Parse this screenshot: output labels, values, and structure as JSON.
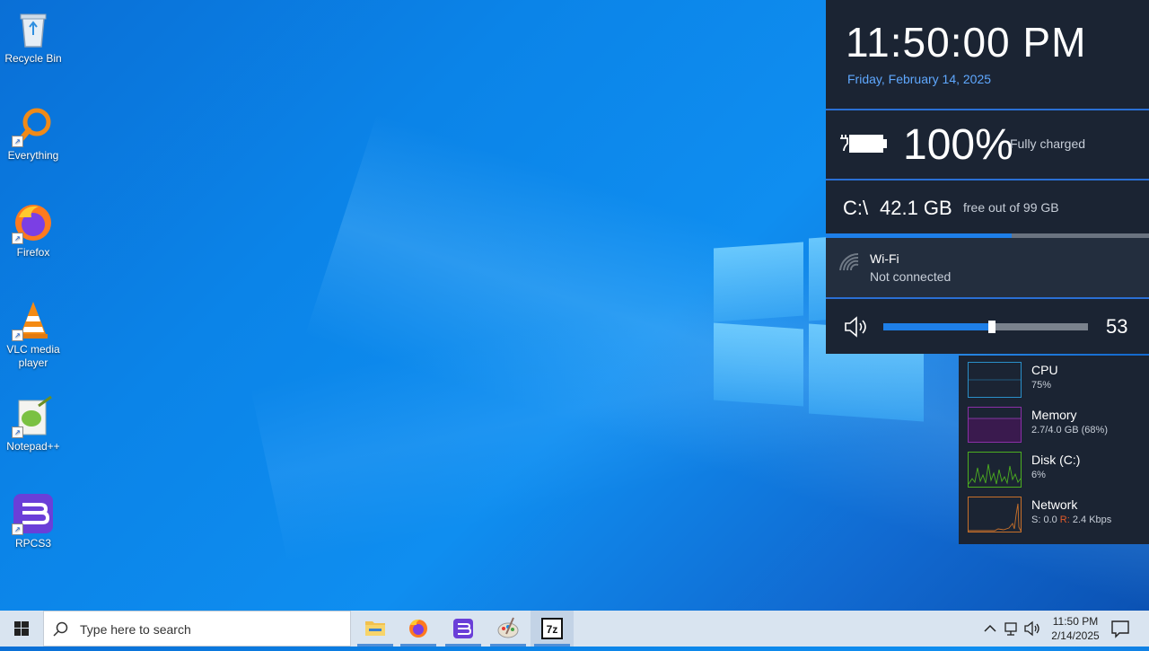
{
  "desktop": {
    "icons": [
      {
        "label": "Recycle Bin",
        "icon": "recycle-bin-icon"
      },
      {
        "label": "Everything",
        "icon": "everything-search-icon"
      },
      {
        "label": "Firefox",
        "icon": "firefox-icon"
      },
      {
        "label": "VLC media player",
        "icon": "vlc-icon"
      },
      {
        "label": "Notepad++",
        "icon": "notepadpp-icon"
      },
      {
        "label": "RPCS3",
        "icon": "rpcs3-icon"
      }
    ]
  },
  "flyout": {
    "time": "11:50:00 PM",
    "date": "Friday, February 14, 2025",
    "battery": {
      "percent_label": "100%",
      "status": "Fully charged"
    },
    "disk": {
      "drive": "C:\\",
      "free": "42.1 GB",
      "of": "free out of 99 GB",
      "used_fraction": 0.575
    },
    "wifi": {
      "name": "Wi-Fi",
      "status": "Not connected"
    },
    "volume": {
      "value": "53",
      "level": 0.53
    }
  },
  "perf": [
    {
      "name": "CPU",
      "value": "75%",
      "color": "#2a8fc9"
    },
    {
      "name": "Memory",
      "value": "2.7/4.0 GB (68%)",
      "color": "#8b2fa8"
    },
    {
      "name": "Disk (C:)",
      "value": "6%",
      "color": "#4caf20"
    },
    {
      "name": "Network",
      "value_prefix": "S: 0.0 ",
      "value_r": "R:",
      "value_suffix": " 2.4 Kbps",
      "color": "#c8702a"
    }
  ],
  "taskbar": {
    "search_placeholder": "Type here to search",
    "apps": [
      "file-explorer-icon",
      "firefox-icon",
      "rpcs3-icon",
      "paint-icon",
      "7zip-icon"
    ],
    "sevenzip_label": "7z",
    "tray_time": "11:50 PM",
    "tray_date": "2/14/2025"
  },
  "colors": {
    "accent": "#1e7fe8",
    "flyout_bg": "#1b2433",
    "date": "#5fa8ff"
  }
}
